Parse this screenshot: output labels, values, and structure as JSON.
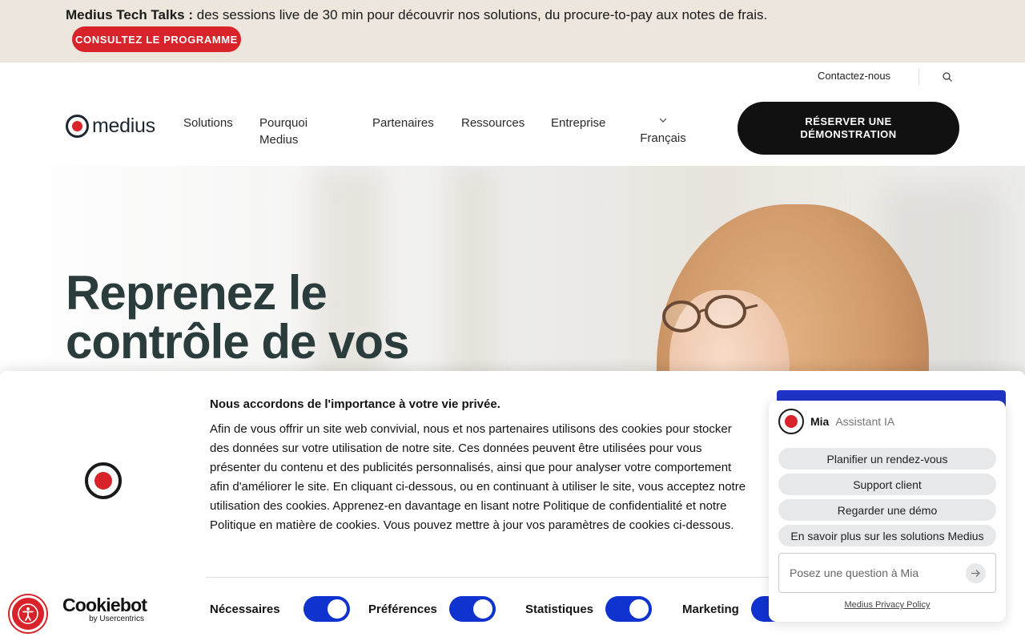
{
  "banner": {
    "title": "Medius Tech Talks :",
    "text": " des sessions live de 30 min pour découvrir nos solutions, du procure-to-pay aux notes de frais.",
    "cta": "CONSULTEZ LE PROGRAMME"
  },
  "header": {
    "contact": "Contactez-nous",
    "logo_text": "medius",
    "nav": {
      "solutions": "Solutions",
      "pourquoi_line1": "Pourquoi",
      "pourquoi_line2": "Medius",
      "partenaires": "Partenaires",
      "ressources": "Ressources",
      "entreprise": "Entreprise"
    },
    "language": "Français",
    "demo_line1": "RÉSERVER UNE",
    "demo_line2": "DÉMONSTRATION"
  },
  "hero": {
    "title_line1": "Reprenez le",
    "title_line2": "contrôle de vos"
  },
  "cookie": {
    "title": "Nous accordons de l'importance à votre vie privée.",
    "body": "Afin de vous offrir un site web convivial, nous et nos partenaires utilisons des cookies pour stocker des données sur votre utilisation de notre site. Ces données peuvent être utilisées pour vous présenter du contenu et des publicités personnalisés, ainsi que pour analyser votre comportement afin d'améliorer le site. En cliquant ci-dessous, ou en continuant à utiliser le site, vous acceptez notre utilisation des cookies. Apprenez-en davantage en lisant notre Politique de confidentialité et notre Politique en matière de cookies. Vous pouvez mettre à jour vos paramètres de cookies ci-dessous.",
    "toggles": {
      "necessary": "Nécessaires",
      "preferences": "Préférences",
      "statistics": "Statistiques",
      "marketing": "Marketing"
    },
    "brand_name": "Cookiebot",
    "brand_by": "by Usercentrics"
  },
  "chat": {
    "name": "Mia",
    "role": "Assistant IA",
    "chips": [
      "Planifier un rendez-vous",
      "Support client",
      "Regarder une démo",
      "En savoir plus sur les solutions Medius"
    ],
    "placeholder": "Posez une question à Mia",
    "policy": "Medius Privacy Policy"
  },
  "colors": {
    "brand_red": "#d8232a",
    "toggle_blue": "#1032cf",
    "heading": "#2b3c3c"
  }
}
